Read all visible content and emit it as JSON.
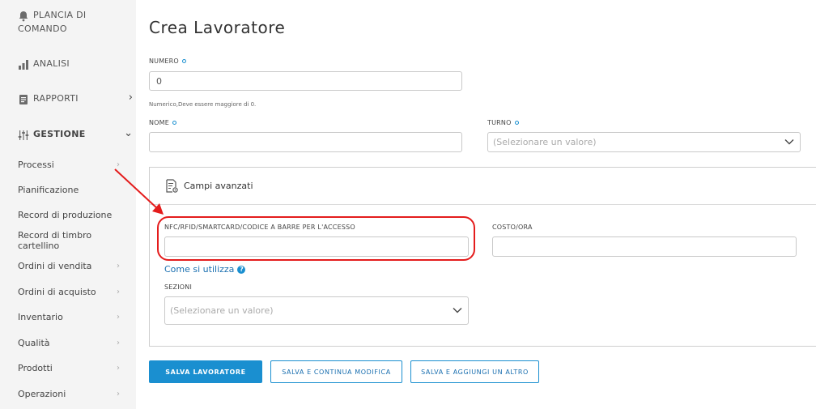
{
  "sidebar": {
    "top_items": [
      {
        "label": "PLANCIA DI COMANDO",
        "label_line1": "PLANCIA DI",
        "label_line2": "COMANDO",
        "icon": "bell-icon"
      },
      {
        "label": "ANALISI",
        "icon": "bar-chart-icon"
      },
      {
        "label": "RAPPORTI",
        "icon": "report-icon"
      },
      {
        "label": "GESTIONE",
        "icon": "sliders-icon"
      }
    ],
    "sub_items": [
      {
        "label": "Processi"
      },
      {
        "label": "Pianificazione"
      },
      {
        "label": "Record di produzione"
      },
      {
        "label": "Record di timbro cartellino"
      },
      {
        "label": "Ordini di vendita"
      },
      {
        "label": "Ordini di acquisto"
      },
      {
        "label": "Inventario"
      },
      {
        "label": "Qualità"
      },
      {
        "label": "Prodotti"
      },
      {
        "label": "Operazioni"
      }
    ]
  },
  "page": {
    "title": "Crea Lavoratore"
  },
  "form": {
    "numero": {
      "label": "NUMERO",
      "value": "0",
      "hint": "Numerico,Deve essere maggiore di 0."
    },
    "nome": {
      "label": "NOME",
      "value": ""
    },
    "turno": {
      "label": "TURNO",
      "placeholder": "(Selezionare un valore)"
    },
    "advanced": {
      "title": "Campi avanzati",
      "nfc": {
        "label": "NFC/RFID/SMARTCARD/CODICE A BARRE PER L'ACCESSO",
        "value": ""
      },
      "costo": {
        "label": "COSTO/ORA",
        "value": ""
      },
      "help_link": "Come si utilizza",
      "sezioni": {
        "label": "SEZIONI",
        "placeholder": "(Selezionare un valore)"
      }
    }
  },
  "buttons": {
    "save": "SALVA LAVORATORE",
    "save_continue": "SALVA E CONTINUA MODIFICA",
    "save_add": "SALVA E AGGIUNGI UN ALTRO"
  },
  "colors": {
    "accent": "#1a8fd0",
    "annotation": "#e41c1c"
  }
}
